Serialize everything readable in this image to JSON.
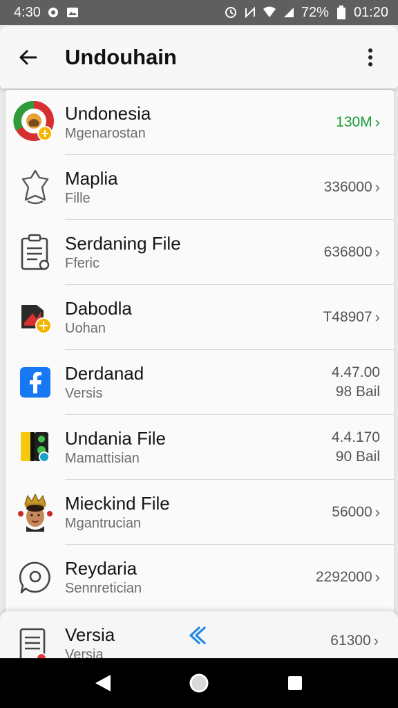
{
  "status_bar": {
    "time_left": "4:30",
    "battery_text": "72%",
    "time_right": "01:20"
  },
  "app_bar": {
    "title": "Undouhain"
  },
  "items": [
    {
      "name": "Undonesia",
      "sub": "Mgenarostan",
      "meta": "130M",
      "meta_color": "#1a9a35",
      "icon": "chrome-flag-icon"
    },
    {
      "name": "Maplia",
      "sub": "Fille",
      "meta": "336000",
      "icon": "bell-icon"
    },
    {
      "name": "Serdaning File",
      "sub": "Fferic",
      "meta": "636800",
      "icon": "document-icon"
    },
    {
      "name": "Dabodla",
      "sub": "Uohan",
      "meta": "T48907",
      "icon": "folder-app-icon"
    },
    {
      "name": "Derdanad",
      "sub": "Versis",
      "meta": "4.47.00",
      "meta2": "98 Bail",
      "icon": "facebook-icon"
    },
    {
      "name": "Undania File",
      "sub": "Mamattisian",
      "meta": "4.4.170",
      "meta2": "90 Bail",
      "icon": "app-tile-icon"
    },
    {
      "name": "Mieckind File",
      "sub": "Mgantrucian",
      "meta": "56000",
      "icon": "avatar-icon"
    },
    {
      "name": "Reydaria",
      "sub": "Sennretician",
      "meta": "2292000",
      "icon": "chat-icon"
    }
  ],
  "bottom_item": {
    "name": "Versia",
    "sub": "Versia",
    "meta": "61300",
    "icon": "document-badge-icon"
  },
  "colors": {
    "accent_green": "#1a9a35",
    "facebook_blue": "#1877f2",
    "link_blue": "#1e88e5"
  }
}
